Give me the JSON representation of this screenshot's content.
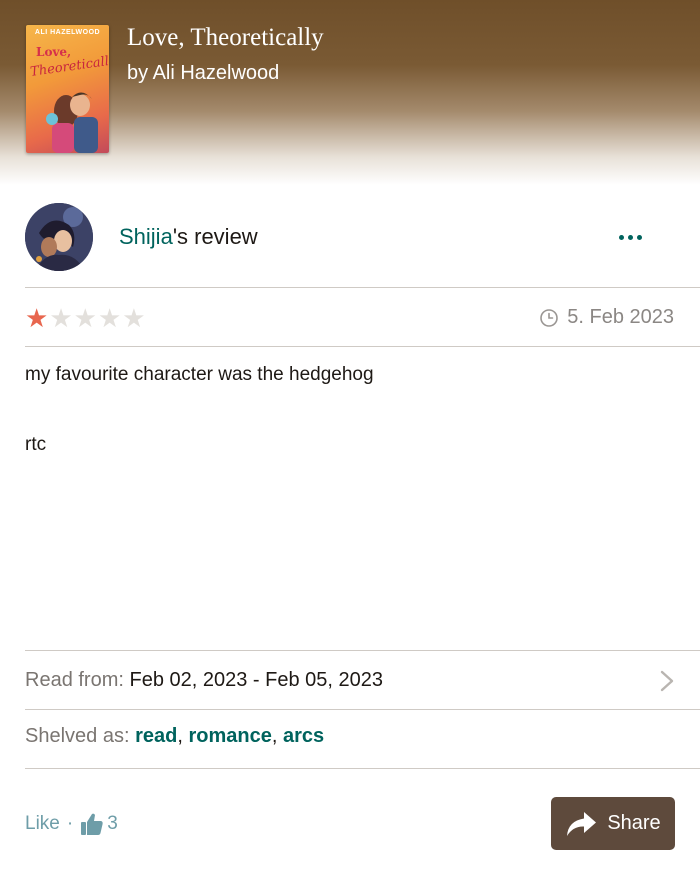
{
  "book": {
    "title": "Love, Theoretically",
    "author_line": "by Ali Hazelwood",
    "cover": {
      "author": "ALI HAZELWOOD",
      "title_word1": "Love,",
      "title_word2": "Theoretically"
    }
  },
  "review": {
    "reviewer": "Shijia",
    "heading_suffix": "'s review",
    "rating": 1,
    "rating_max": 5,
    "date": "5. Feb 2023",
    "body_line1": "my favourite character was the hedgehog",
    "body_line2": "rtc"
  },
  "details": {
    "read_label": "Read from:",
    "read_value": "Feb 02, 2023 - Feb 05, 2023",
    "shelved_label": "Shelved as:",
    "shelves": [
      "read",
      "romance",
      "arcs"
    ]
  },
  "actions": {
    "like_label": "Like",
    "separator": "·",
    "like_count": "3",
    "share_label": "Share"
  },
  "colors": {
    "accent": "#00635d",
    "star_on": "#e8664e",
    "star_off": "#e3e0dc",
    "share_bg": "#5e4a3c",
    "like_text": "#6e9da8"
  },
  "icons": [
    "more-icon",
    "clock-icon",
    "chevron-right-icon",
    "thumbs-up-icon",
    "share-arrow-icon"
  ]
}
